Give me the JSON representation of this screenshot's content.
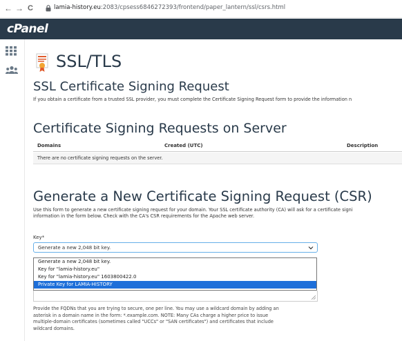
{
  "browser": {
    "back": "←",
    "forward": "→",
    "reload": "C",
    "url_host": "lamia-history.eu",
    "url_rest": ":2083/cpsess6846272393/frontend/paper_lantern/ssl/csrs.html"
  },
  "header": {
    "logo": "cPanel"
  },
  "sidebar": {
    "items": [
      {
        "icon": "grid-icon"
      },
      {
        "icon": "users-icon"
      }
    ]
  },
  "page": {
    "title": "SSL/TLS",
    "csr_heading": "SSL Certificate Signing Request",
    "csr_intro": "If you obtain a certificate from a trusted SSL provider, you must complete the Certificate Signing Request form to provide the information n"
  },
  "server_csrs": {
    "heading": "Certificate Signing Requests on Server",
    "columns": [
      "Domains",
      "Created (UTC)",
      "Description"
    ],
    "empty_message": "There are no certificate signing requests on the server."
  },
  "generate": {
    "heading": "Generate a New Certificate Signing Request (CSR)",
    "intro_line1": "Use this form to generate a new certificate signing request for your domain. Your SSL certificate authority (CA) will ask for a certificate signi",
    "intro_line2": "information in the form below. Check with the CA's CSR requirements for the Apache web server.",
    "key_label": "Key*",
    "key_selected": "Generate a new 2,048 bit key.",
    "key_options": [
      "Generate a new 2,048 bit key.",
      "Key for \"lamia-history.eu\"",
      "Key for \"lamia-history.eu\" 1603800422.0",
      "Private Key for LAMIA-HISTORY"
    ],
    "highlighted_option_index": 3,
    "help_lines": [
      "Provide the FQDNs that you are trying to secure, one per line. You may use a wildcard domain by adding an",
      "asterisk in a domain name in the form: *.example.com. NOTE: Many CAs charge a higher price to issue",
      "multiple-domain certificates (sometimes called \"UCCs\" or \"SAN certificates\") and certificates that include",
      "wildcard domains."
    ]
  },
  "colors": {
    "header_bg": "#293a4a",
    "title_color": "#293a4a",
    "highlight": "#1e6fd9",
    "focus_border": "#66afe9"
  }
}
